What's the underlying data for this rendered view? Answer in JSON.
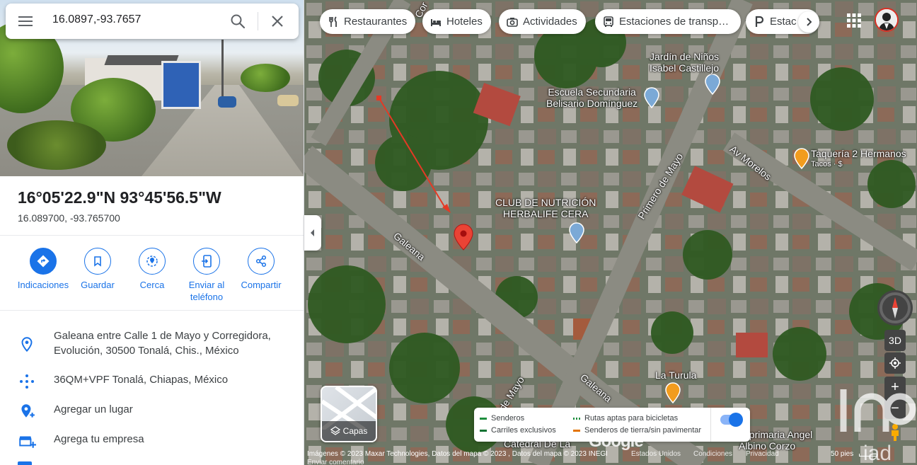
{
  "search": {
    "query": "16.0897,-93.7657"
  },
  "place": {
    "title": "16°05'22.9\"N 93°45'56.5\"W",
    "decimal": "16.089700, -93.765700"
  },
  "actions": [
    {
      "label": "Indicaciones",
      "icon": "directions-icon"
    },
    {
      "label": "Guardar",
      "icon": "bookmark-icon"
    },
    {
      "label": "Cerca",
      "icon": "nearby-icon"
    },
    {
      "label": "Enviar al teléfono",
      "icon": "send-to-phone-icon"
    },
    {
      "label": "Compartir",
      "icon": "share-icon"
    }
  ],
  "info": {
    "address": "Galeana entre Calle 1 de Mayo y Corregidora, Evolución, 30500 Tonalá, Chis., México",
    "plus_code": "36QM+VPF Tonalá, Chiapas, México",
    "add_place": "Agregar un lugar",
    "add_business": "Agrega tu empresa"
  },
  "chips": [
    {
      "label": "Restaurantes",
      "icon": "fork-knife-icon"
    },
    {
      "label": "Hoteles",
      "icon": "bed-icon"
    },
    {
      "label": "Actividades",
      "icon": "camera-icon"
    },
    {
      "label": "Estaciones de transp…",
      "icon": "bus-icon"
    },
    {
      "label": "Estac",
      "icon": "parking-icon"
    }
  ],
  "map_labels": {
    "kinder": "Jardín de Niños\nIsabel Castillejo",
    "secundaria": "Escuela Secundaria\nBelisario Domínguez",
    "taqueria": "Taquería 2 Hermanos",
    "taqueria_sub": "Tacos · $",
    "club": "CLUB DE NUTRICIÓN\nHERBALIFE CERA",
    "turula": "La Turula",
    "primaria": "c. primaria Angel\nAlbino Corzo",
    "catedral": "Catedral De La",
    "street_galeana": "Galeana",
    "street_galeana2": "Galeana",
    "street_primero": "Primero de Mayo",
    "street_mayo": "de Mayo",
    "street_morelos": "Av Morelos",
    "street_corr": "Cor"
  },
  "layers": {
    "label": "Capas"
  },
  "legend": {
    "senderos": "Senderos",
    "carriles": "Carriles exclusivos",
    "rutas": "Rutas aptas para bicicletas",
    "tierra": "Senderos de tierra/sin pavimentar"
  },
  "attribution": {
    "images": "Imágenes © 2023 Maxar Technologies, Datos del mapa © 2023 , Datos del mapa © 2023 INEGI",
    "country": "Estados Unidos",
    "terms": "Condiciones",
    "privacy": "Privacidad",
    "feedback": "Enviar comentario",
    "scale": "50 pies"
  },
  "controls": {
    "three_d": "3D"
  },
  "colors": {
    "accent": "#1a73e8",
    "pin": "#ea4335",
    "arrow": "#e53925"
  }
}
